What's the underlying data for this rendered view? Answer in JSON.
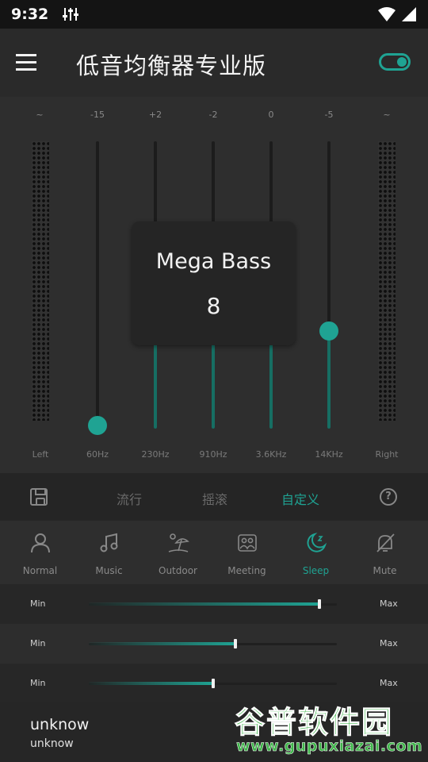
{
  "statusbar": {
    "time": "9:32"
  },
  "header": {
    "title": "低音均衡器专业版",
    "enabled": true
  },
  "colors": {
    "accent": "#1fa393",
    "background": "#2b2b2b"
  },
  "equalizer": {
    "channels": [
      {
        "top": "~",
        "bottom": "Left"
      },
      {
        "top": "~",
        "bottom": "Right"
      }
    ],
    "bands": [
      {
        "top": "-15",
        "bottom": "60Hz",
        "level": 0.01
      },
      {
        "top": "+2",
        "bottom": "230Hz",
        "level": 0.32
      },
      {
        "top": "-2",
        "bottom": "910Hz",
        "level": 0.32
      },
      {
        "top": "0",
        "bottom": "3.6KHz",
        "level": 0.32
      },
      {
        "top": "-5",
        "bottom": "14KHz",
        "level": 0.34
      }
    ]
  },
  "popup": {
    "title": "Mega Bass",
    "value": "8"
  },
  "presets": {
    "save_icon": "save-icon",
    "tabs": [
      "流行",
      "摇滚",
      "自定义"
    ],
    "active": 2,
    "help_icon": "help-icon"
  },
  "modes": [
    {
      "label": "Normal",
      "icon": "person-icon"
    },
    {
      "label": "Music",
      "icon": "music-note-icon"
    },
    {
      "label": "Outdoor",
      "icon": "beach-umbrella-icon"
    },
    {
      "label": "Meeting",
      "icon": "group-icon"
    },
    {
      "label": "Sleep",
      "icon": "moon-icon"
    },
    {
      "label": "Mute",
      "icon": "mute-bell-icon"
    }
  ],
  "active_mode": 4,
  "sliders": [
    {
      "min": "Min",
      "max": "Max",
      "value": 0.93
    },
    {
      "min": "Min",
      "max": "Max",
      "value": 0.59
    },
    {
      "min": "Min",
      "max": "Max",
      "value": 0.5
    }
  ],
  "now_playing": {
    "title": "unknow",
    "artist": "unknow"
  },
  "watermark": {
    "text": "谷普软件园",
    "url": "www.gupuxiazai.com"
  }
}
